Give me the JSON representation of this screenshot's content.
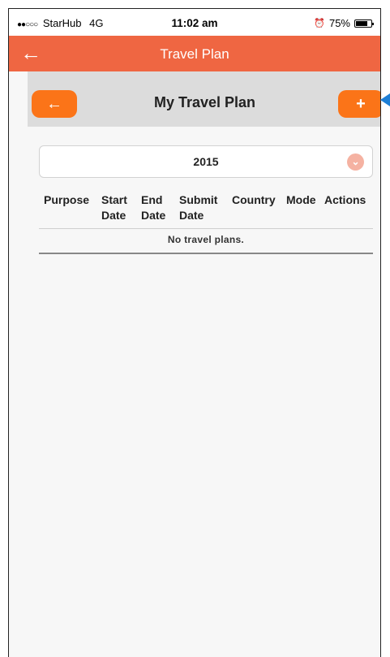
{
  "status_bar": {
    "signal": "●●○○○",
    "carrier": "StarHub",
    "network": "4G",
    "time": "11:02 am",
    "battery_text": "75%",
    "battery_level": 0.75
  },
  "nav": {
    "back_glyph": "←",
    "title": "Travel Plan"
  },
  "subheader": {
    "title": "My Travel Plan",
    "back_glyph": "←",
    "add_glyph": "+"
  },
  "year_select": {
    "value": "2015",
    "chevron_glyph": "⌄"
  },
  "table": {
    "columns": [
      {
        "line1": "Purpose",
        "line2": ""
      },
      {
        "line1": "Start",
        "line2": "Date"
      },
      {
        "line1": "End",
        "line2": "Date"
      },
      {
        "line1": "Submit",
        "line2": "Date"
      },
      {
        "line1": "Country",
        "line2": ""
      },
      {
        "line1": "Mode",
        "line2": ""
      },
      {
        "line1": "Actions",
        "line2": ""
      }
    ],
    "empty_message": "No travel plans."
  },
  "colors": {
    "nav_bg": "#ef6642",
    "button_orange": "#fb7418",
    "pointer_blue": "#1e7fd6"
  }
}
